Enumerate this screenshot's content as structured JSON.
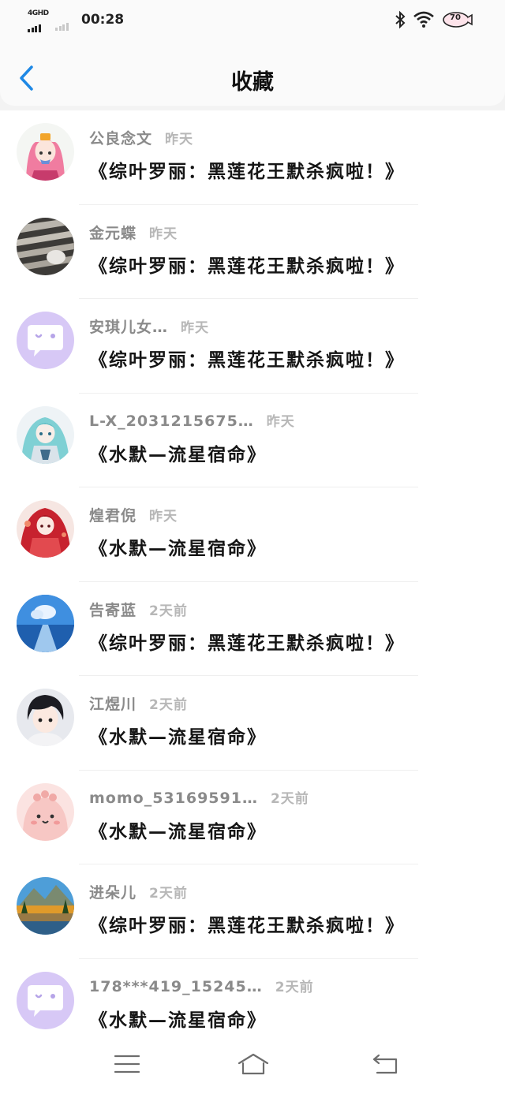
{
  "status_bar": {
    "network": "4GHD",
    "time": "00:28",
    "battery": "70"
  },
  "header": {
    "title": "收藏"
  },
  "items": [
    {
      "name": "公良念文",
      "time": "昨天",
      "book": "《综叶罗丽：黑莲花王默杀疯啦！》",
      "avatar": "anime-girl-pink"
    },
    {
      "name": "金元蝶",
      "time": "昨天",
      "book": "《综叶罗丽：黑莲花王默杀疯啦！》",
      "avatar": "striped-photo"
    },
    {
      "name": "安琪儿女…",
      "time": "昨天",
      "book": "《综叶罗丽：黑莲花王默杀疯啦！》",
      "avatar": "default-chat"
    },
    {
      "name": "L-X_2031215675…",
      "time": "昨天",
      "book": "《水默—流星宿命》",
      "avatar": "anime-teal"
    },
    {
      "name": "煌君倪",
      "time": "昨天",
      "book": "《水默—流星宿命》",
      "avatar": "anime-red"
    },
    {
      "name": "告寄蓝",
      "time": "2天前",
      "book": "《综叶罗丽：黑莲花王默杀疯啦！》",
      "avatar": "sky-landscape"
    },
    {
      "name": "江煜川",
      "time": "2天前",
      "book": "《水默—流星宿命》",
      "avatar": "anime-boy"
    },
    {
      "name": "momo_53169591…",
      "time": "2天前",
      "book": "《水默—流星宿命》",
      "avatar": "pink-blob"
    },
    {
      "name": "进朵儿",
      "time": "2天前",
      "book": "《综叶罗丽：黑莲花王默杀疯啦！》",
      "avatar": "lake-landscape"
    },
    {
      "name": "178***419_15245…",
      "time": "2天前",
      "book": "《水默—流星宿命》",
      "avatar": "default-chat"
    }
  ],
  "nav": {
    "menu": "menu-icon",
    "home": "home-icon",
    "back": "back-icon"
  },
  "colors": {
    "accent": "#1e88e5",
    "default_avatar": "#d7c8f6"
  }
}
